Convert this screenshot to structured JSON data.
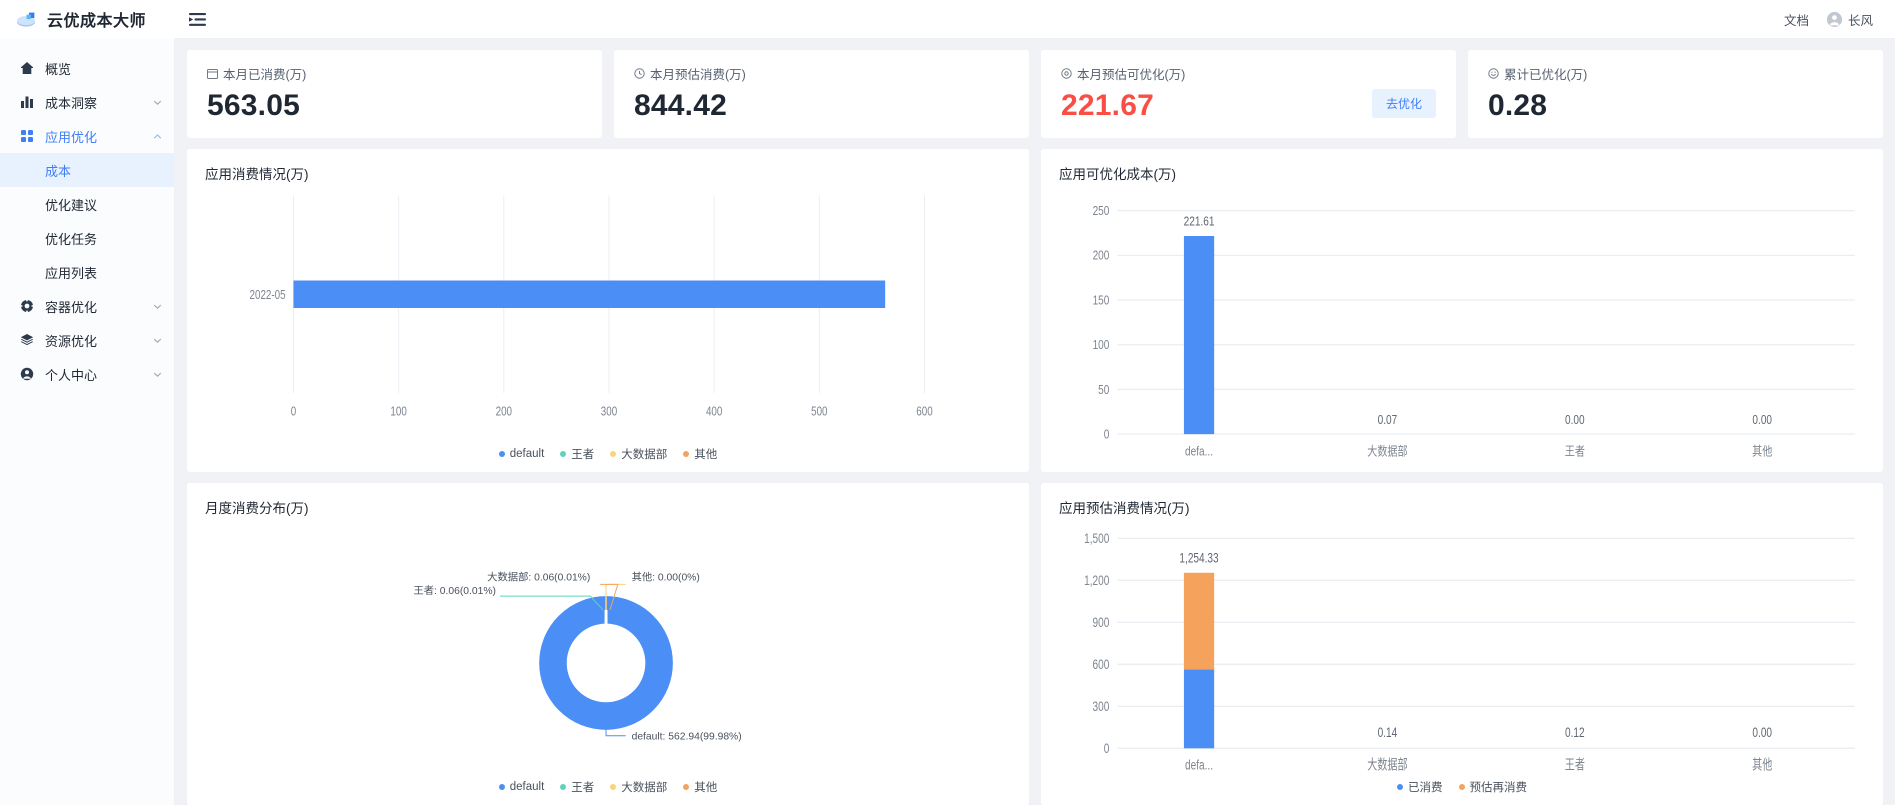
{
  "header": {
    "logo_title": "云优成本大师",
    "fold_icon": "menu-fold-icon",
    "doc_link": "文档",
    "user_name": "长风"
  },
  "sidebar": {
    "items": [
      {
        "label": "概览",
        "icon": "home-icon",
        "has_chevron": false,
        "active": false,
        "sub": false
      },
      {
        "label": "成本洞察",
        "icon": "bar-chart-icon",
        "has_chevron": true,
        "active": false,
        "sub": false
      },
      {
        "label": "应用优化",
        "icon": "apps-icon",
        "has_chevron": true,
        "active": true,
        "sub": false
      },
      {
        "label": "成本",
        "icon": "",
        "has_chevron": false,
        "active": false,
        "sub": true,
        "selected": true
      },
      {
        "label": "优化建议",
        "icon": "",
        "has_chevron": false,
        "active": false,
        "sub": true,
        "selected": false
      },
      {
        "label": "优化任务",
        "icon": "",
        "has_chevron": false,
        "active": false,
        "sub": true,
        "selected": false
      },
      {
        "label": "应用列表",
        "icon": "",
        "has_chevron": false,
        "active": false,
        "sub": true,
        "selected": false
      },
      {
        "label": "容器优化",
        "icon": "container-icon",
        "has_chevron": true,
        "active": false,
        "sub": false
      },
      {
        "label": "资源优化",
        "icon": "layers-icon",
        "has_chevron": true,
        "active": false,
        "sub": false
      },
      {
        "label": "个人中心",
        "icon": "user-circle-icon",
        "has_chevron": true,
        "active": false,
        "sub": false
      }
    ]
  },
  "stats": [
    {
      "label": "本月已消费(万)",
      "icon": "calendar-icon",
      "value": "563.05",
      "danger": false,
      "action": null
    },
    {
      "label": "本月预估消费(万)",
      "icon": "clock-icon",
      "value": "844.42",
      "danger": false,
      "action": null
    },
    {
      "label": "本月预估可优化(万)",
      "icon": "target-icon",
      "value": "221.67",
      "danger": true,
      "action": "去优化"
    },
    {
      "label": "累计已优化(万)",
      "icon": "smile-icon",
      "value": "0.28",
      "danger": false,
      "action": null
    }
  ],
  "colors": {
    "blue": "#4b8ef5",
    "teal": "#5ed3bc",
    "yellow": "#fbd37b",
    "orange": "#f5a35c",
    "danger": "#fa4e44",
    "accent": "#3f7ff5"
  },
  "chart_data": [
    {
      "id": "app-consume",
      "type": "bar",
      "orientation": "horizontal",
      "title": "应用消费情况(万)",
      "categories": [
        "2022-05"
      ],
      "series": [
        {
          "name": "default",
          "values": [
            562.94
          ],
          "color": "#4b8ef5"
        },
        {
          "name": "王者",
          "values": [
            0.06
          ],
          "color": "#5ed3bc"
        },
        {
          "name": "大数据部",
          "values": [
            0.06
          ],
          "color": "#fbd37b"
        },
        {
          "name": "其他",
          "values": [
            0.0
          ],
          "color": "#f5a35c"
        }
      ],
      "xticks": [
        "0",
        "100",
        "200",
        "300",
        "400",
        "500",
        "600"
      ],
      "xlim": [
        0,
        600
      ],
      "legend": [
        "default",
        "王者",
        "大数据部",
        "其他"
      ],
      "legend_position": "bottom",
      "grid": true
    },
    {
      "id": "app-optimizable",
      "type": "bar",
      "orientation": "vertical",
      "title": "应用可优化成本(万)",
      "categories": [
        "defa...",
        "大数据部",
        "王者",
        "其他"
      ],
      "values": [
        221.61,
        0.07,
        0.0,
        0.0
      ],
      "data_labels": [
        "221.61",
        "0.07",
        "0.00",
        "0.00"
      ],
      "yticks": [
        "0",
        "50",
        "100",
        "150",
        "200",
        "250"
      ],
      "ylim": [
        0,
        250
      ],
      "color": "#4b8ef5",
      "grid": true
    },
    {
      "id": "monthly-distribution",
      "type": "pie",
      "variant": "donut",
      "title": "月度消费分布(万)",
      "slices": [
        {
          "name": "default",
          "value": 562.94,
          "percent": "99.98%",
          "label": "default: 562.94(99.98%)",
          "color": "#4b8ef5"
        },
        {
          "name": "王者",
          "value": 0.06,
          "percent": "0.01%",
          "label": "王者: 0.06(0.01%)",
          "color": "#5ed3bc"
        },
        {
          "name": "大数据部",
          "value": 0.06,
          "percent": "0.01%",
          "label": "大数据部: 0.06(0.01%)",
          "color": "#fbd37b"
        },
        {
          "name": "其他",
          "value": 0.0,
          "percent": "0%",
          "label": "其他: 0.00(0%)",
          "color": "#f5a35c"
        }
      ],
      "legend": [
        "default",
        "王者",
        "大数据部",
        "其他"
      ],
      "legend_position": "bottom"
    },
    {
      "id": "app-estimated",
      "type": "bar",
      "orientation": "vertical",
      "stacked": true,
      "title": "应用预估消费情况(万)",
      "categories": [
        "defa...",
        "大数据部",
        "王者",
        "其他"
      ],
      "series": [
        {
          "name": "已消费",
          "values": [
            562.94,
            0.14,
            0.12,
            0.0
          ],
          "color": "#4b8ef5"
        },
        {
          "name": "预估再消费",
          "values": [
            691.39,
            0.0,
            0.0,
            0.0
          ],
          "color": "#f5a35c"
        }
      ],
      "data_labels": [
        "1,254.33",
        "0.14",
        "0.12",
        "0.00"
      ],
      "yticks": [
        "0",
        "300",
        "600",
        "900",
        "1,200",
        "1,500"
      ],
      "ylim": [
        0,
        1500
      ],
      "legend": [
        "已消费",
        "预估再消费"
      ],
      "legend_position": "bottom",
      "grid": true
    }
  ]
}
